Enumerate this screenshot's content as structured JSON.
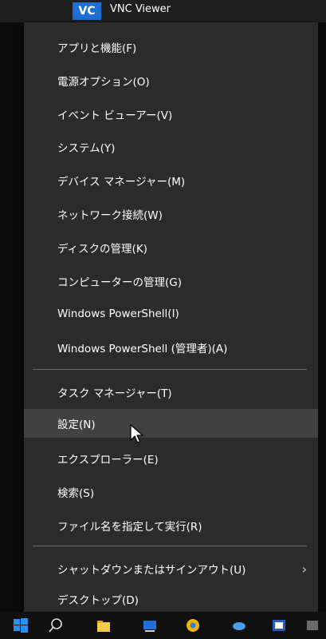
{
  "background": {
    "app_title": "VNC Viewer",
    "app_logo_text": "VC"
  },
  "menu": {
    "items": [
      {
        "label": "アプリと機能(F)"
      },
      {
        "label": "電源オプション(O)"
      },
      {
        "label": "イベント ビューアー(V)"
      },
      {
        "label": "システム(Y)"
      },
      {
        "label": "デバイス マネージャー(M)"
      },
      {
        "label": "ネットワーク接続(W)"
      },
      {
        "label": "ディスクの管理(K)"
      },
      {
        "label": "コンピューターの管理(G)"
      },
      {
        "label": "Windows PowerShell(I)"
      },
      {
        "label": "Windows PowerShell (管理者)(A)"
      },
      {
        "label": "タスク マネージャー(T)"
      },
      {
        "label": "設定(N)"
      },
      {
        "label": "エクスプローラー(E)"
      },
      {
        "label": "検索(S)"
      },
      {
        "label": "ファイル名を指定して実行(R)"
      },
      {
        "label": "シャットダウンまたはサインアウト(U)"
      },
      {
        "label": "デスクトップ(D)"
      }
    ],
    "submenu_chevron": "›"
  },
  "taskbar": {
    "icons": [
      "start-icon",
      "search-icon",
      "file-explorer-icon",
      "desktop-icon",
      "chrome-icon",
      "app-icon",
      "word-icon",
      "app2-icon"
    ]
  },
  "colors": {
    "menu_bg": "#2b2b2b",
    "hover_bg": "#414141",
    "accent": "#1e6fd6"
  }
}
